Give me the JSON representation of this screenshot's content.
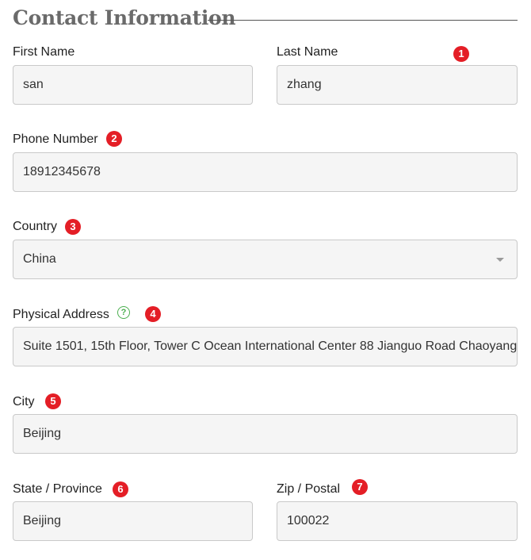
{
  "section": {
    "title": "Contact Information"
  },
  "fields": {
    "first_name": {
      "label": "First Name",
      "value": "san"
    },
    "last_name": {
      "label": "Last Name",
      "value": "zhang",
      "badge": "1"
    },
    "phone": {
      "label": "Phone Number",
      "value": "18912345678",
      "badge": "2"
    },
    "country": {
      "label": "Country",
      "value": "China",
      "badge": "3"
    },
    "address": {
      "label": "Physical Address",
      "help": "?",
      "value": "Suite 1501, 15th Floor, Tower C Ocean International Center 88 Jianguo Road Chaoyang",
      "badge": "4"
    },
    "city": {
      "label": "City",
      "value": "Beijing",
      "badge": "5"
    },
    "state": {
      "label": "State / Province",
      "value": "Beijing",
      "badge": "6"
    },
    "zip": {
      "label": "Zip / Postal",
      "value": "100022",
      "badge": "7"
    }
  },
  "colors": {
    "badge": "#e41e26",
    "help": "#4caf50",
    "field_bg": "#f5f5f5",
    "title": "#6a6a6a"
  }
}
